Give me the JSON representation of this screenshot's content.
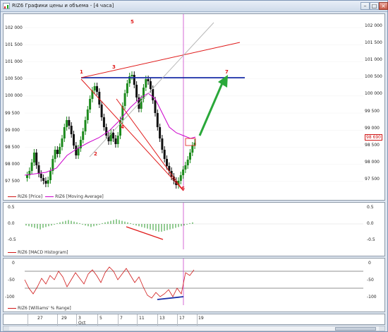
{
  "window": {
    "title": "RIZ6 Графики цены и объема - [4 часа]"
  },
  "price_pane": {
    "y_ticks": [
      "102 000",
      "101 500",
      "101 000",
      "100 500",
      "100 000",
      "99 500",
      "99 000",
      "98 500",
      "98 000",
      "97 500"
    ],
    "last_price": "98 690",
    "legend": [
      {
        "label": "RIZ6 [Price]",
        "color": "#d01818"
      },
      {
        "label": "RIZ6 [Moving Average]",
        "color": "#cc00cc"
      }
    ],
    "annotations": [
      "1",
      "2",
      "3",
      "4",
      "5",
      "6",
      "7"
    ],
    "colors": {
      "up": "#1c8a1c",
      "down": "#111111",
      "ma": "#cc00cc",
      "resistance": "#1a2ea8",
      "trend": "#e01a1a",
      "arrow": "#2aa83a"
    }
  },
  "macd_pane": {
    "y_ticks": [
      "0.5",
      "0.0",
      "-0.5"
    ],
    "legend": [
      {
        "label": "RIZ6 [MACD Histogram]",
        "color": "#d01818"
      }
    ]
  },
  "wr_pane": {
    "y_ticks": [
      "0",
      "-50",
      "-100"
    ],
    "legend": [
      {
        "label": "RIZ6 [Williams' % Range]",
        "color": "#d01818"
      }
    ]
  },
  "date_axis": {
    "days": [
      "27",
      "29",
      "3",
      "5",
      "7",
      "11",
      "13",
      "17",
      "19"
    ],
    "month": "Oct"
  }
}
